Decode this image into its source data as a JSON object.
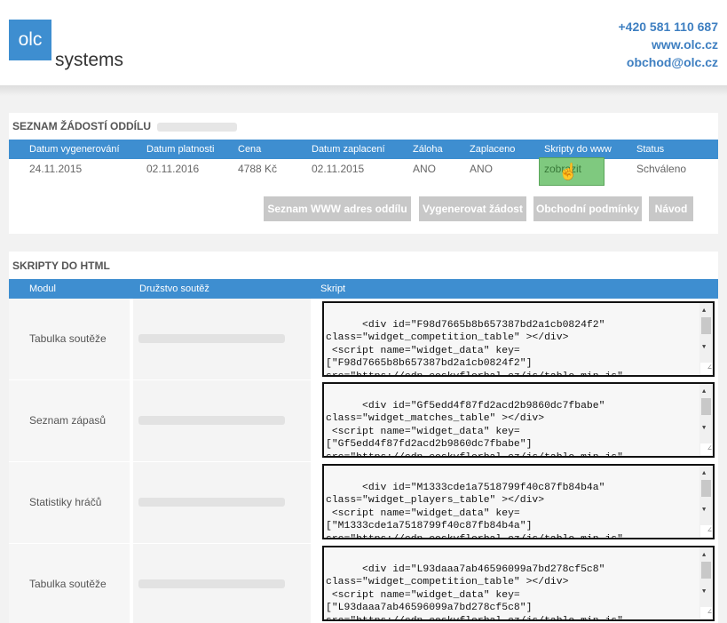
{
  "header": {
    "logo_box": "olc",
    "logo_text": "systems",
    "phone": "+420 581 110 687",
    "web": "www.olc.cz",
    "email": "obchod@olc.cz"
  },
  "requests": {
    "title": "SEZNAM ŽÁDOSTÍ ODDÍLU",
    "columns": [
      "Datum vygenerování",
      "Datum platnosti",
      "Cena",
      "Datum zaplacení",
      "Záloha",
      "Zaplaceno",
      "Skripty do www",
      "Status"
    ],
    "row": [
      "24.11.2015",
      "02.11.2016",
      "4788 Kč",
      "02.11.2015",
      "ANO",
      "ANO",
      "zobrazit",
      "Schváleno"
    ],
    "buttons": [
      "Seznam WWW adres oddílu",
      "Vygenerovat žádost",
      "Obchodní podmínky",
      "Návod"
    ]
  },
  "scripts": {
    "title": "SKRIPTY DO HTML",
    "columns": [
      "Modul",
      "Družstvo soutěž",
      "Skript"
    ],
    "rows": [
      {
        "module": "Tabulka soutěže",
        "script": "<div id=\"F98d7665b8b657387bd2a1cb0824f2\"\nclass=\"widget_competition_table\" ></div>\n <script name=\"widget_data\" key=\n[\"F98d7665b8b657387bd2a1cb0824f2\"]\nsrc=\"https://cdn.ceskyflorbal.cz/js/table-min.js\""
      },
      {
        "module": "Seznam zápasů",
        "script": "<div id=\"Gf5edd4f87fd2acd2b9860dc7fbabe\"\nclass=\"widget_matches_table\" ></div>\n <script name=\"widget_data\" key=\n[\"Gf5edd4f87fd2acd2b9860dc7fbabe\"]\nsrc=\"https://cdn.ceskyflorbal.cz/js/table-min.js\""
      },
      {
        "module": "Statistiky hráčů",
        "script": "<div id=\"M1333cde1a7518799f40c87fb84b4a\"\nclass=\"widget_players_table\" ></div>\n <script name=\"widget_data\" key=\n[\"M1333cde1a7518799f40c87fb84b4a\"]\nsrc=\"https://cdn.ceskyflorbal.cz/js/table-min.js\""
      },
      {
        "module": "Tabulka soutěže",
        "script": "<div id=\"L93daaa7ab46596099a7bd278cf5c8\"\nclass=\"widget_competition_table\" ></div>\n <script name=\"widget_data\" key=\n[\"L93daaa7ab46596099a7bd278cf5c8\"]\nsrc=\"https://cdn.ceskyflorbal.cz/js/table-min.js\""
      }
    ]
  },
  "icons": {
    "hand_cursor": "hand-pointer-icon",
    "scroll_up": "arrow-up-icon",
    "scroll_down": "arrow-down-icon",
    "resize": "resize-grip-icon"
  },
  "colors": {
    "accent": "#3e8ed0",
    "contact_text": "#3e7fc1",
    "button_gray": "#c8c8c8",
    "highlight_green": "#7fc97f"
  }
}
